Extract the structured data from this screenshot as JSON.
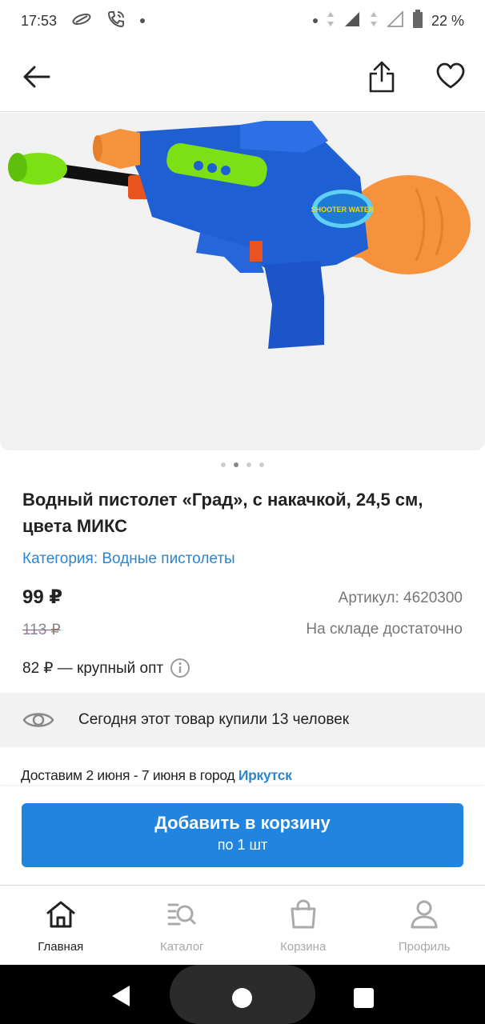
{
  "status_bar": {
    "time": "17:53",
    "battery": "22 %"
  },
  "product": {
    "title": "Водный пистолет «Град», с накачкой, 24,5 см, цвета МИКС",
    "category": "Категория: Водные пистолеты",
    "price": "99 ₽",
    "old_price": "113 ₽",
    "article": "Артикул: 4620300",
    "stock": "На складе достаточно",
    "wholesale": "82 ₽ — крупный опт",
    "image_label": "SHOOTER WATER"
  },
  "gallery": {
    "total": 4,
    "active": 2
  },
  "social_proof": {
    "text": "Сегодня этот товар купили 13 человек"
  },
  "delivery": {
    "text": "Доставим 2 июня - 7 июня в город ",
    "city": "Иркутск"
  },
  "cart_button": {
    "label": "Добавить в корзину",
    "sub": "по 1 шт"
  },
  "tabs": [
    {
      "label": "Главная",
      "icon": "home-icon",
      "active": true
    },
    {
      "label": "Каталог",
      "icon": "catalog-search-icon",
      "active": false
    },
    {
      "label": "Корзина",
      "icon": "basket-icon",
      "active": false
    },
    {
      "label": "Профиль",
      "icon": "profile-icon",
      "active": false
    }
  ],
  "colors": {
    "accent": "#2184de",
    "link": "#2a86d1",
    "strike": "#e33333"
  }
}
